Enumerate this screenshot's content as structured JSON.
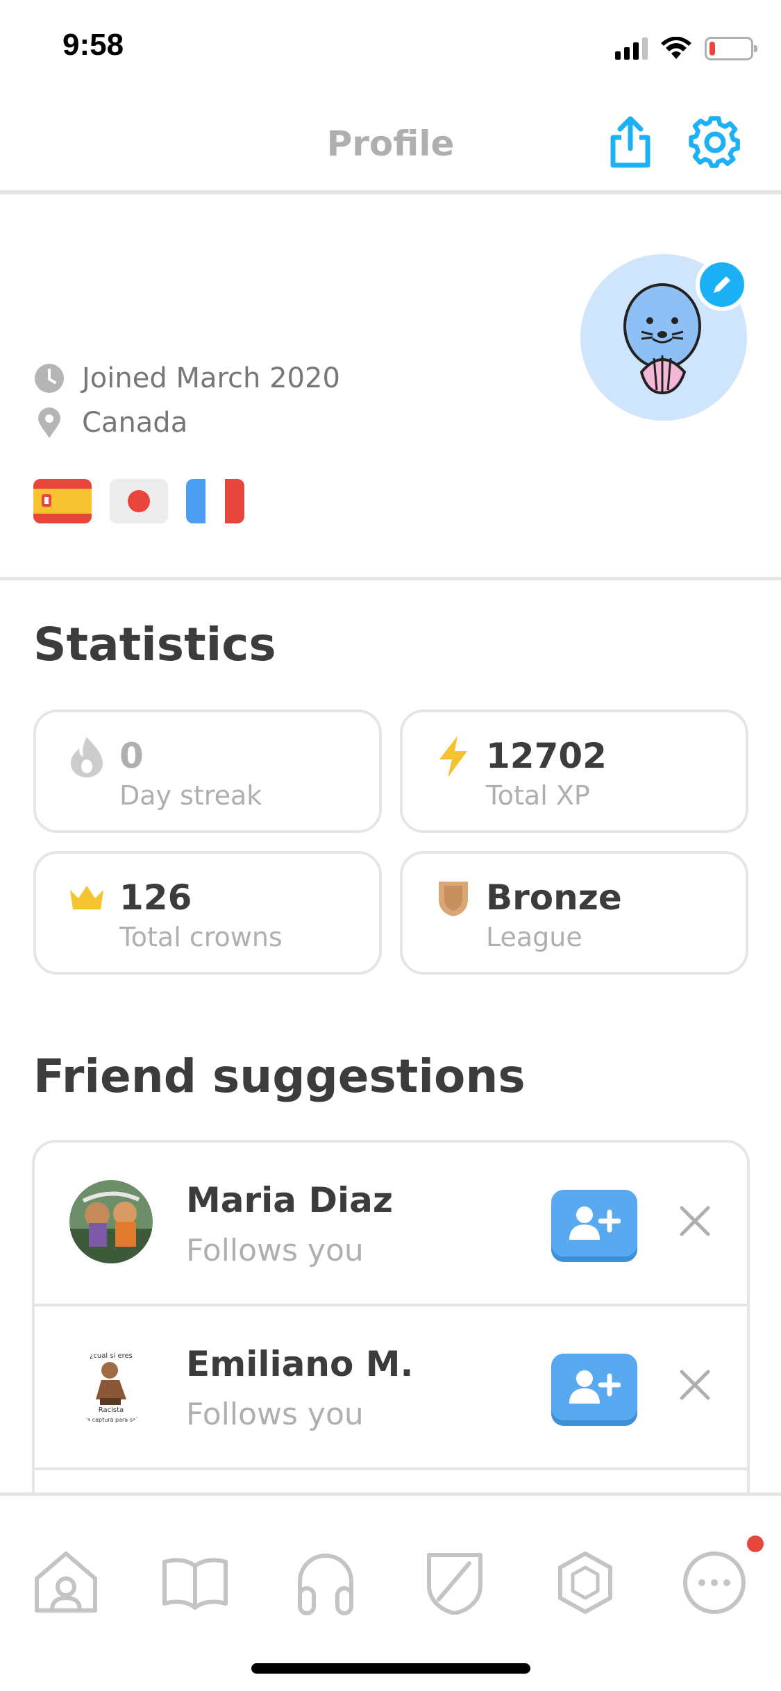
{
  "status_bar": {
    "time": "9:58",
    "battery_level_percent": 15,
    "battery_color": "#e8453c"
  },
  "header": {
    "title": "Profile",
    "share_icon": "share-icon",
    "settings_icon": "gear-icon",
    "accent_color": "#1cb0f6"
  },
  "profile": {
    "joined": "Joined March 2020",
    "location": "Canada",
    "languages": [
      "spanish-flag-icon",
      "japanese-flag-icon",
      "french-flag-icon"
    ],
    "edit_icon": "pencil-icon"
  },
  "statistics": {
    "title": "Statistics",
    "cards": [
      {
        "icon": "flame-icon",
        "value": "0",
        "label": "Day streak"
      },
      {
        "icon": "lightning-icon",
        "value": "12702",
        "label": "Total XP"
      },
      {
        "icon": "crown-icon",
        "value": "126",
        "label": "Total crowns"
      },
      {
        "icon": "bronze-shield-icon",
        "value": "Bronze",
        "label": "League"
      }
    ]
  },
  "friends": {
    "title": "Friend suggestions",
    "items": [
      {
        "name": "Maria Diaz",
        "subtitle": "Follows you"
      },
      {
        "name": "Emiliano M.",
        "subtitle": "Follows you",
        "avatar_text_top": "¿cual si eres",
        "avatar_text_mid": "Racista",
        "avatar_text_bottom": "Saca captura para saber"
      }
    ]
  },
  "bottom_nav": {
    "items": [
      "home-icon",
      "book-icon",
      "headphones-icon",
      "shield-icon",
      "gem-icon",
      "more-icon"
    ],
    "notification_color": "#e8453c"
  }
}
